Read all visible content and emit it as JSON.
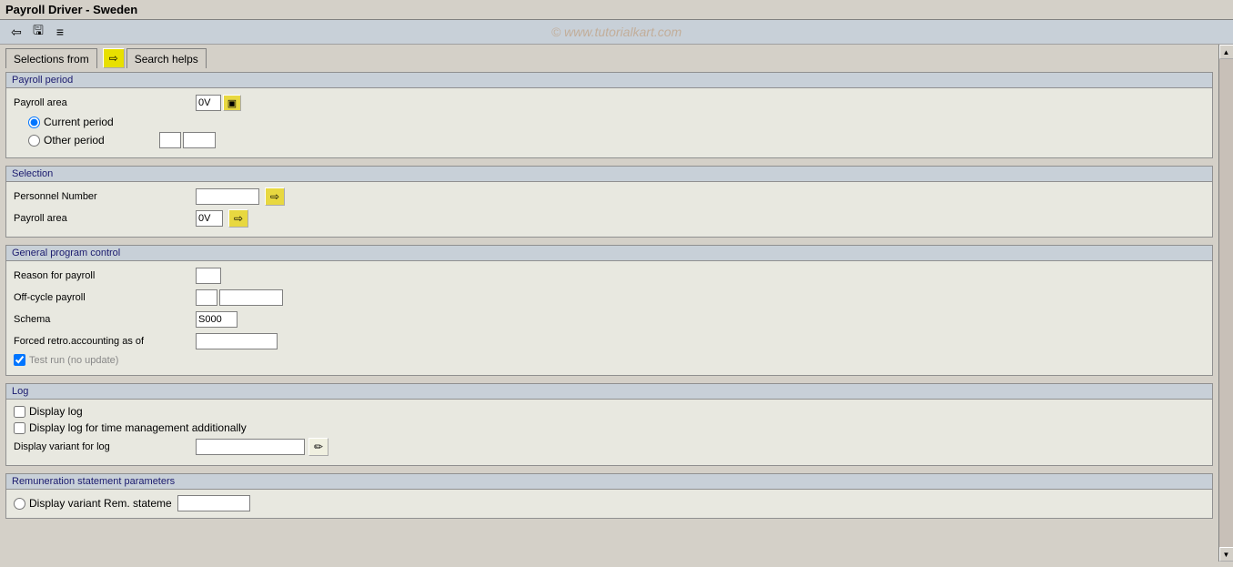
{
  "title": "Payroll Driver - Sweden",
  "watermark": "© www.tutorialkart.com",
  "toolbar": {
    "icons": [
      "back-icon",
      "save-icon",
      "menu-icon"
    ]
  },
  "tabs": {
    "selections_from": "Selections from",
    "search_helps": "Search helps"
  },
  "sections": {
    "payroll_period": {
      "header": "Payroll period",
      "payroll_area_label": "Payroll area",
      "payroll_area_value": "0V",
      "current_period_label": "Current period",
      "other_period_label": "Other period"
    },
    "selection": {
      "header": "Selection",
      "personnel_number_label": "Personnel Number",
      "payroll_area_label": "Payroll area",
      "payroll_area_value": "0V"
    },
    "general_program_control": {
      "header": "General program control",
      "reason_for_payroll_label": "Reason for payroll",
      "off_cycle_payroll_label": "Off-cycle payroll",
      "schema_label": "Schema",
      "schema_value": "S000",
      "forced_retro_label": "Forced retro.accounting as of",
      "test_run_label": "Test run (no update)",
      "test_run_checked": true
    },
    "log": {
      "header": "Log",
      "display_log_label": "Display log",
      "display_log_time_label": "Display log for time management additionally",
      "display_variant_label": "Display variant for log"
    },
    "remuneration": {
      "header": "Remuneration statement parameters",
      "display_variant_rem_label": "Display variant Rem. stateme"
    }
  }
}
